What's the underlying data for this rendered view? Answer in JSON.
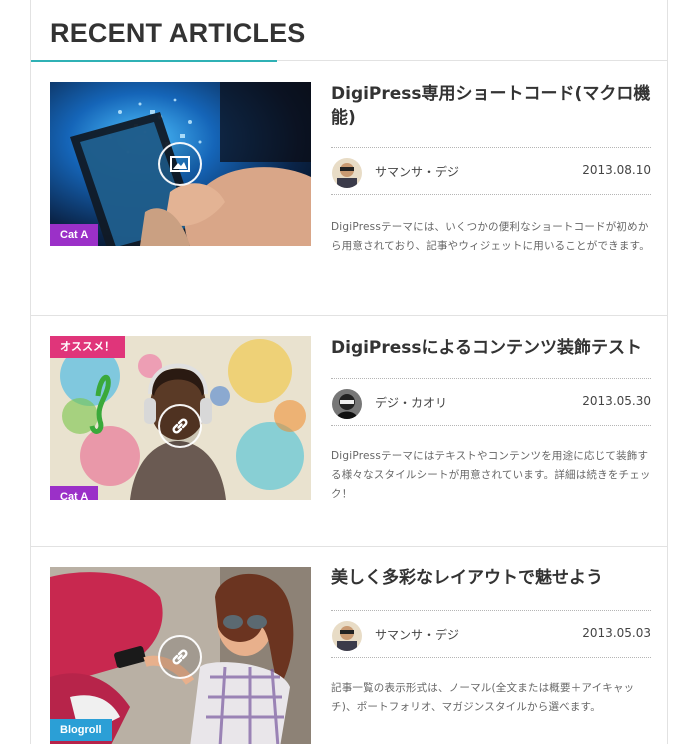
{
  "section": {
    "title": "RECENT ARTICLES"
  },
  "colors": {
    "accent": "#2fb1b5",
    "cat_a": "#9b30c8",
    "blogroll": "#2b9fd6",
    "recommend": "#e0357a"
  },
  "articles": [
    {
      "title": "DigiPress専用ショートコード(マクロ機能)",
      "category": "Cat A",
      "author": "サマンサ・デジ",
      "date": "2013.08.10",
      "excerpt": "DigiPressテーマには、いくつかの便利なショートコードが初めから用意されており、記事やウィジェットに用いることができます。",
      "thumb_icon": "image-icon"
    },
    {
      "title": "DigiPressによるコンテンツ装飾テスト",
      "category": "Cat A",
      "badge": "オススメ！",
      "author": "デジ・カオリ",
      "date": "2013.05.30",
      "excerpt": "DigiPressテーマにはテキストやコンテンツを用途に応じて装飾する様々なスタイルシートが用意されています。詳細は続きをチェック！",
      "thumb_icon": "link-icon"
    },
    {
      "title": "美しく多彩なレイアウトで魅せよう",
      "category": "Blogroll",
      "author": "サマンサ・デジ",
      "date": "2013.05.03",
      "excerpt": "記事一覧の表示形式は、ノーマル(全文または概要＋アイキャッチ)、ポートフォリオ、マガジンスタイルから選べます。",
      "thumb_icon": "link-icon"
    }
  ]
}
